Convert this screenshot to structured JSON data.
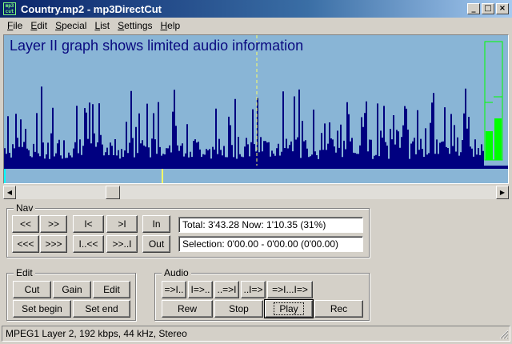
{
  "window": {
    "title": "Country.mp2 - mp3DirectCut",
    "icon_text": "mp3 cut",
    "controls": {
      "minimize": "_",
      "maximize": "□",
      "close": "×"
    }
  },
  "menu": [
    {
      "label": "File",
      "key": "F",
      "rest": "ile"
    },
    {
      "label": "Edit",
      "key": "E",
      "rest": "dit"
    },
    {
      "label": "Special",
      "key": "S",
      "rest": "pecial"
    },
    {
      "label": "List",
      "key": "L",
      "rest": "ist"
    },
    {
      "label": "Settings",
      "key": "S",
      "rest": "ettings"
    },
    {
      "label": "Help",
      "key": "H",
      "rest": "elp"
    }
  ],
  "waveform": {
    "message": "Layer II graph shows limited audio information",
    "colors": {
      "background": "#89b5d6",
      "wave": "#000080",
      "cursor": "#ffff66",
      "level": "#00ff00"
    }
  },
  "nav": {
    "label": "Nav",
    "buttons_row1": [
      "<<",
      ">>",
      "I<",
      ">I",
      "In"
    ],
    "buttons_row2": [
      "<<<",
      ">>>",
      "I..<<",
      ">>..I",
      "Out"
    ],
    "total_field": "Total: 3'43.28   Now: 1'10.35   (31%)",
    "selection_field": "Selection: 0'00.00 - 0'00.00 (0'00.00)"
  },
  "edit": {
    "label": "Edit",
    "cut": "Cut",
    "gain": "Gain",
    "edit": "Edit",
    "set_begin": "Set begin",
    "set_end": "Set end"
  },
  "audio": {
    "label": "Audio",
    "row1": [
      "=>I..",
      "I=>..",
      "..=>I",
      "..I=>",
      "=>I...I=>"
    ],
    "rew": "Rew",
    "stop": "Stop",
    "play": "Play",
    "rec": "Rec"
  },
  "scrollbar": {
    "left_arrow": "◀",
    "right_arrow": "▶",
    "position_fraction": 0.31
  },
  "status": {
    "text": "MPEG1 Layer 2, 192 kbps, 44 kHz, Stereo"
  }
}
